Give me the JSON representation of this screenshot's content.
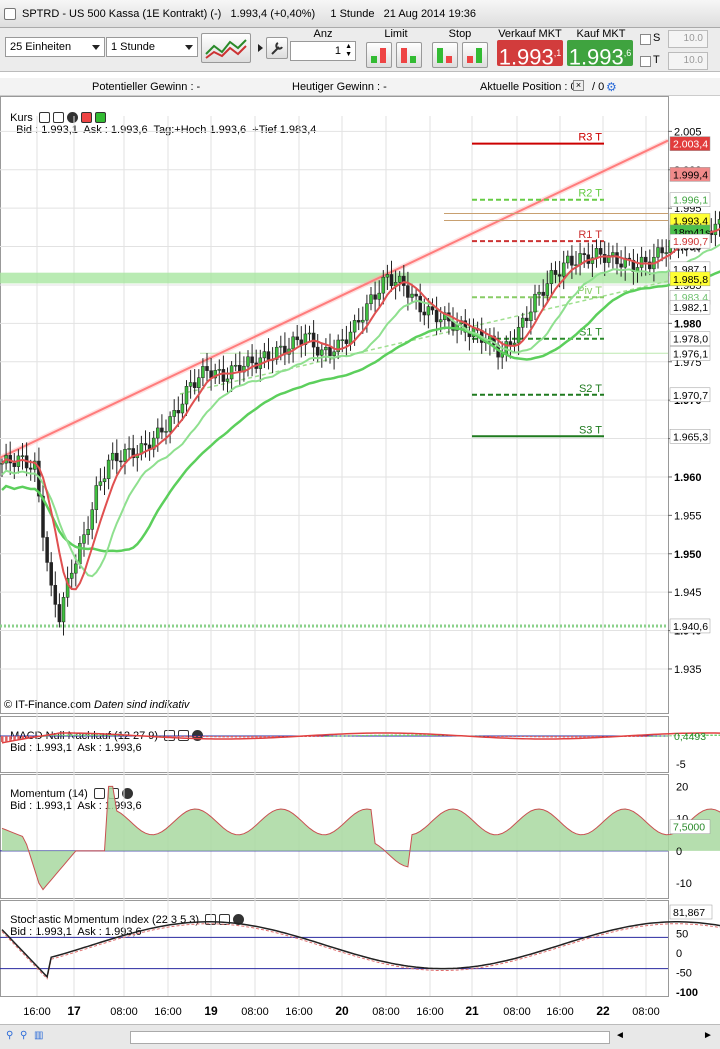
{
  "window": {
    "title": "SPTRD - US 500 Kassa (1E Kontrakt) (-)   1.993,4 (+0,40%)     1 Stunde   21 Aug 2014 19:36"
  },
  "toolbar": {
    "units_select": "25 Einheiten",
    "period_select": "1 Stunde",
    "anz_label": "Anz",
    "anz_value": "1",
    "limit_label": "Limit",
    "stop_label": "Stop",
    "sell_label": "Verkauf MKT",
    "sell_price_main": "1.993",
    "sell_price_sup": ",1",
    "buy_label": "Kauf MKT",
    "buy_price_main": "1.993",
    "buy_price_sup": ",6",
    "s_label": "S",
    "t_label": "T",
    "s_value": "10.0",
    "t_value": "10.0",
    "sell_color": "#d23c3c",
    "buy_color": "#3fa33f"
  },
  "infobar": {
    "potential": "Potentieller Gewinn : -",
    "today": "Heutiger Gewinn : -",
    "position": "Aktuelle Position : 0",
    "position_sep": "/ 0"
  },
  "panels": {
    "main_name": "Kurs",
    "main_info": "Bid : 1.993,1  Ask : 1.993,6  Tag:+Hoch 1.993,6  +Tief 1.983,4",
    "copyright": "© IT-Finance.com",
    "disclaimer": "Daten sind indikativ",
    "macd_name": "MACD Null Nachlauf (12 27 9)",
    "macd_info": "Bid : 1.993,1  Ask : 1.993,6",
    "mom_name": "Momentum (14)",
    "mom_info": "Bid : 1.993,1  Ask : 1.993,6",
    "smi_name": "Stochastic Momentum Index (22 3 5 3)",
    "smi_info": "Bid : 1.993,1  Ask : 1.993,6"
  },
  "chart_data": [
    {
      "type": "candlestick",
      "title": "SPTRD - US 500 Kassa (1E Kontrakt)",
      "y_ticks": [
        1935,
        1940,
        1945,
        1950,
        1955,
        1960,
        1965,
        1970,
        1975,
        1980,
        1985,
        1990,
        1995,
        2000,
        2005
      ],
      "y_tick_labels": [
        "1.935",
        "1.940",
        "1.945",
        "1.950",
        "1.955",
        "1.960",
        "1.965",
        "1.970",
        "1.975",
        "1.980",
        "1.985",
        "1.990",
        "1.995",
        "2.000",
        "2.005"
      ],
      "ylim": [
        1932,
        2007
      ],
      "x_tick_labels": [
        "16:00",
        "17",
        "08:00",
        "16:00",
        "19",
        "08:00",
        "16:00",
        "20",
        "08:00",
        "16:00",
        "21",
        "08:00",
        "16:00",
        "22",
        "08:00"
      ],
      "bold_x_labels": [
        "17",
        "19",
        "20",
        "21",
        "22"
      ],
      "close_path": [
        [
          0,
          1961.8
        ],
        [
          4,
          1962.3
        ],
        [
          8,
          1961.3
        ],
        [
          10,
          1953
        ],
        [
          12,
          1945
        ],
        [
          14,
          1942
        ],
        [
          17,
          1948
        ],
        [
          20,
          1952
        ],
        [
          23,
          1958
        ],
        [
          26,
          1962
        ],
        [
          30,
          1963
        ],
        [
          34,
          1963.5
        ],
        [
          38,
          1965.5
        ],
        [
          42,
          1968
        ],
        [
          46,
          1972
        ],
        [
          50,
          1974
        ],
        [
          54,
          1973
        ],
        [
          58,
          1974.5
        ],
        [
          62,
          1975
        ],
        [
          66,
          1976
        ],
        [
          70,
          1977
        ],
        [
          74,
          1978.5
        ],
        [
          78,
          1976
        ],
        [
          82,
          1977
        ],
        [
          86,
          1979.5
        ],
        [
          90,
          1983
        ],
        [
          94,
          1986
        ],
        [
          98,
          1985
        ],
        [
          102,
          1982
        ],
        [
          106,
          1981
        ],
        [
          110,
          1980
        ],
        [
          114,
          1979
        ],
        [
          118,
          1978
        ],
        [
          122,
          1976
        ],
        [
          126,
          1979
        ],
        [
          130,
          1983
        ],
        [
          134,
          1986
        ],
        [
          138,
          1988
        ],
        [
          142,
          1988.5
        ],
        [
          146,
          1989
        ],
        [
          150,
          1988.2
        ],
        [
          154,
          1987.5
        ],
        [
          158,
          1988
        ],
        [
          162,
          1990
        ],
        [
          166,
          1991
        ],
        [
          170,
          1992
        ],
        [
          174,
          1992.5
        ],
        [
          177,
          1993.4
        ]
      ],
      "price_labels": [
        {
          "text": "2.003,4",
          "value": 2003.4,
          "bg": "#e23c3c",
          "fg": "#ffffff"
        },
        {
          "text": "1.999,4",
          "value": 1999.4,
          "bg": "#f08a8a",
          "fg": "#000000"
        },
        {
          "text": "1.996,1",
          "value": 1996.1,
          "bg": "#ffffff",
          "fg": "#3ea33e"
        },
        {
          "text": "1.993,4",
          "value": 1993.4,
          "bg": "#ffff33",
          "fg": "#000000"
        },
        {
          "text": "18m41s",
          "value": 1991.9,
          "bg": "#4cc04c",
          "fg": "#000000"
        },
        {
          "text": "1.990,7",
          "value": 1990.7,
          "bg": "#ffffff",
          "fg": "#cc3333"
        },
        {
          "text": "1.987,1",
          "value": 1987.1,
          "bg": "#ffffff",
          "fg": "#000000"
        },
        {
          "text": "1.985,8",
          "value": 1985.8,
          "bg": "#ffff33",
          "fg": "#000000"
        },
        {
          "text": "1.983,4",
          "value": 1983.4,
          "bg": "#ffffff",
          "fg": "#6fc06f"
        },
        {
          "text": "1.982,1",
          "value": 1982.1,
          "bg": "#ffffff",
          "fg": "#000000"
        },
        {
          "text": "1.978,0",
          "value": 1978.0,
          "bg": "#ffffff",
          "fg": "#000000"
        },
        {
          "text": "1.976,1",
          "value": 1976.1,
          "bg": "#ffffff",
          "fg": "#000000"
        },
        {
          "text": "1.970,7",
          "value": 1970.7,
          "bg": "#ffffff",
          "fg": "#000000"
        },
        {
          "text": "1.965,3",
          "value": 1965.3,
          "bg": "#ffffff",
          "fg": "#000000"
        },
        {
          "text": "1.940,6",
          "value": 1940.6,
          "bg": "#ffffff",
          "fg": "#000000"
        }
      ],
      "pivots": [
        {
          "name": "R3 T",
          "value": 2003.4,
          "color": "#cc0000",
          "dash": false
        },
        {
          "name": "R2 T",
          "value": 1996.1,
          "color": "#66cc44",
          "dash": true
        },
        {
          "name": "R1 T",
          "value": 1990.7,
          "color": "#cc3333",
          "dash": true
        },
        {
          "name": "Piv T",
          "value": 1983.4,
          "color": "#88cc66",
          "dash": true
        },
        {
          "name": "S1 T",
          "value": 1978.0,
          "color": "#2a8a2a",
          "dash": true
        },
        {
          "name": "S2 T",
          "value": 1970.7,
          "color": "#1f7a1f",
          "dash": true
        },
        {
          "name": "S3 T",
          "value": 1965.3,
          "color": "#1f7a1f",
          "dash": false
        }
      ]
    },
    {
      "type": "area",
      "title": "MACD Null Nachlauf (12 27 9)",
      "value_label": "0,4493",
      "y_ticks": [
        -5
      ],
      "y_tick_labels": [
        "-5"
      ]
    },
    {
      "type": "area",
      "title": "Momentum (14)",
      "value_label": "7,5000",
      "y_ticks": [
        20,
        10,
        0,
        -10
      ],
      "y_tick_labels": [
        "20",
        "10",
        "0",
        "-10"
      ],
      "ylim": [
        -14,
        22
      ]
    },
    {
      "type": "line",
      "title": "Stochastic Momentum Index (22 3 5 3)",
      "value_label": "81,867",
      "y_ticks": [
        100,
        50,
        0,
        -50,
        -100
      ],
      "y_tick_labels": [
        "100",
        "50",
        "0",
        "-50",
        "-100"
      ],
      "ylim": [
        -100,
        100
      ]
    }
  ]
}
